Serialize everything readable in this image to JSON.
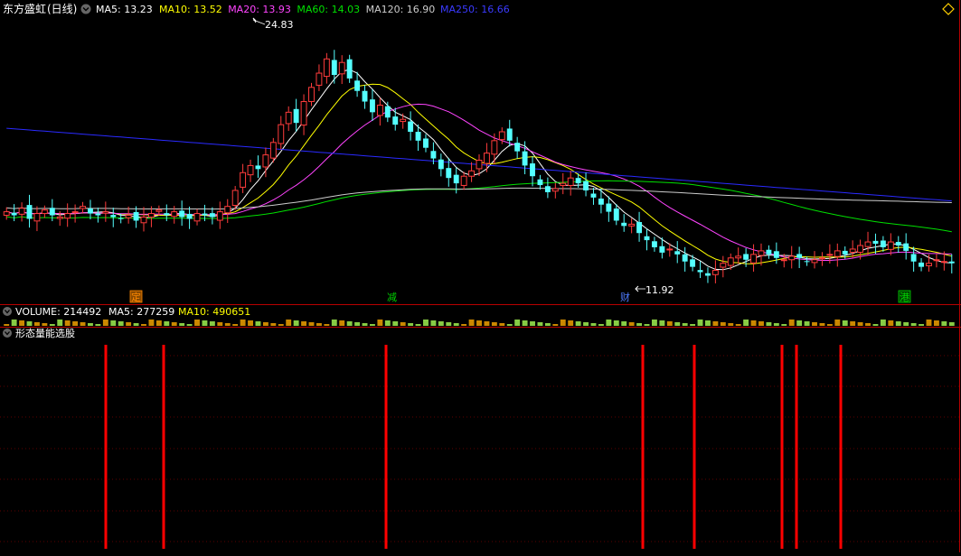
{
  "colors": {
    "background": "#000000",
    "panel_border": "#b80000",
    "grid": "#7a0000",
    "up": "#ff3c3c",
    "down": "#54ffff",
    "ma5": "#ffffff",
    "ma10": "#ffff00",
    "ma20": "#ff44ff",
    "ma60": "#00e000",
    "ma120": "#cccccc",
    "ma250": "#2a2aff",
    "label_text": "#ffffff",
    "signal": "#ff0000"
  },
  "price_panel": {
    "stock_name": "东方盛虹",
    "period": "(日线)",
    "ma_readouts": [
      {
        "label": "MA5: 13.23",
        "color": "#ffffff"
      },
      {
        "label": "MA10: 13.52",
        "color": "#ffff00"
      },
      {
        "label": "MA20: 13.93",
        "color": "#ff44ff"
      },
      {
        "label": "MA60: 14.03",
        "color": "#00e000"
      },
      {
        "label": "MA120: 16.90",
        "color": "#cccccc"
      },
      {
        "label": "MA250: 16.66",
        "color": "#3a3aff"
      }
    ],
    "high_label": "24.83",
    "low_label": "11.92",
    "event_markers": [
      {
        "label": "定",
        "color": "#ff8800"
      },
      {
        "label": "减",
        "color": "#00d000"
      },
      {
        "label": "财",
        "color": "#4f7bff"
      },
      {
        "label": "港",
        "color": "#00d000"
      }
    ]
  },
  "volume_panel": {
    "title": "VOLUME: 214492",
    "ma5": "MA5: 277259",
    "ma10": "MA10: 490651"
  },
  "signal_panel": {
    "title": "形态量能选股"
  },
  "icons": {
    "collapse": "chevron-down-icon",
    "diamond": "diamond-icon"
  },
  "chart_data": {
    "type": "candlestick",
    "y_range": [
      10.5,
      26.5
    ],
    "candles_close_path": [
      15.6,
      15.4,
      15.8,
      15.2,
      15.5,
      15.7,
      15.4,
      15.3,
      15.5,
      15.6,
      15.9,
      15.5,
      15.4,
      15.6,
      15.3,
      15.2,
      15.4,
      15.1,
      15.3,
      15.5,
      15.7,
      15.4,
      15.6,
      15.3,
      15.2,
      15.5,
      15.4,
      15.3,
      15.6,
      15.9,
      16.8,
      17.8,
      18.2,
      18.0,
      18.8,
      19.5,
      20.5,
      21.2,
      20.6,
      21.8,
      22.6,
      23.4,
      24.2,
      23.3,
      24.0,
      23.1,
      22.4,
      21.8,
      21.2,
      21.6,
      20.9,
      20.5,
      20.8,
      20.1,
      19.6,
      19.2,
      18.6,
      18.0,
      17.5,
      17.2,
      17.6,
      17.9,
      18.5,
      18.9,
      19.6,
      20.1,
      19.6,
      19.0,
      18.2,
      17.6,
      17.1,
      16.7,
      16.9,
      17.2,
      17.5,
      17.2,
      16.8,
      16.4,
      16.0,
      15.6,
      15.1,
      14.8,
      14.9,
      14.4,
      14.0,
      13.6,
      13.3,
      13.5,
      13.2,
      12.8,
      12.5,
      12.2,
      12.0,
      12.3,
      12.7,
      13.0,
      13.1,
      12.9,
      13.2,
      13.4,
      13.2,
      13.0,
      12.9,
      13.1,
      13.0,
      12.8,
      12.9,
      13.0,
      13.2,
      13.4,
      13.2,
      13.5,
      13.7,
      13.9,
      13.8,
      13.6,
      13.9,
      13.7,
      13.4,
      12.8,
      12.5,
      12.7,
      12.9,
      12.8,
      12.7
    ],
    "high": 24.83,
    "low": 11.92,
    "signal_bars_at_index": [
      12,
      20,
      52,
      87,
      94,
      106,
      108,
      114
    ]
  }
}
